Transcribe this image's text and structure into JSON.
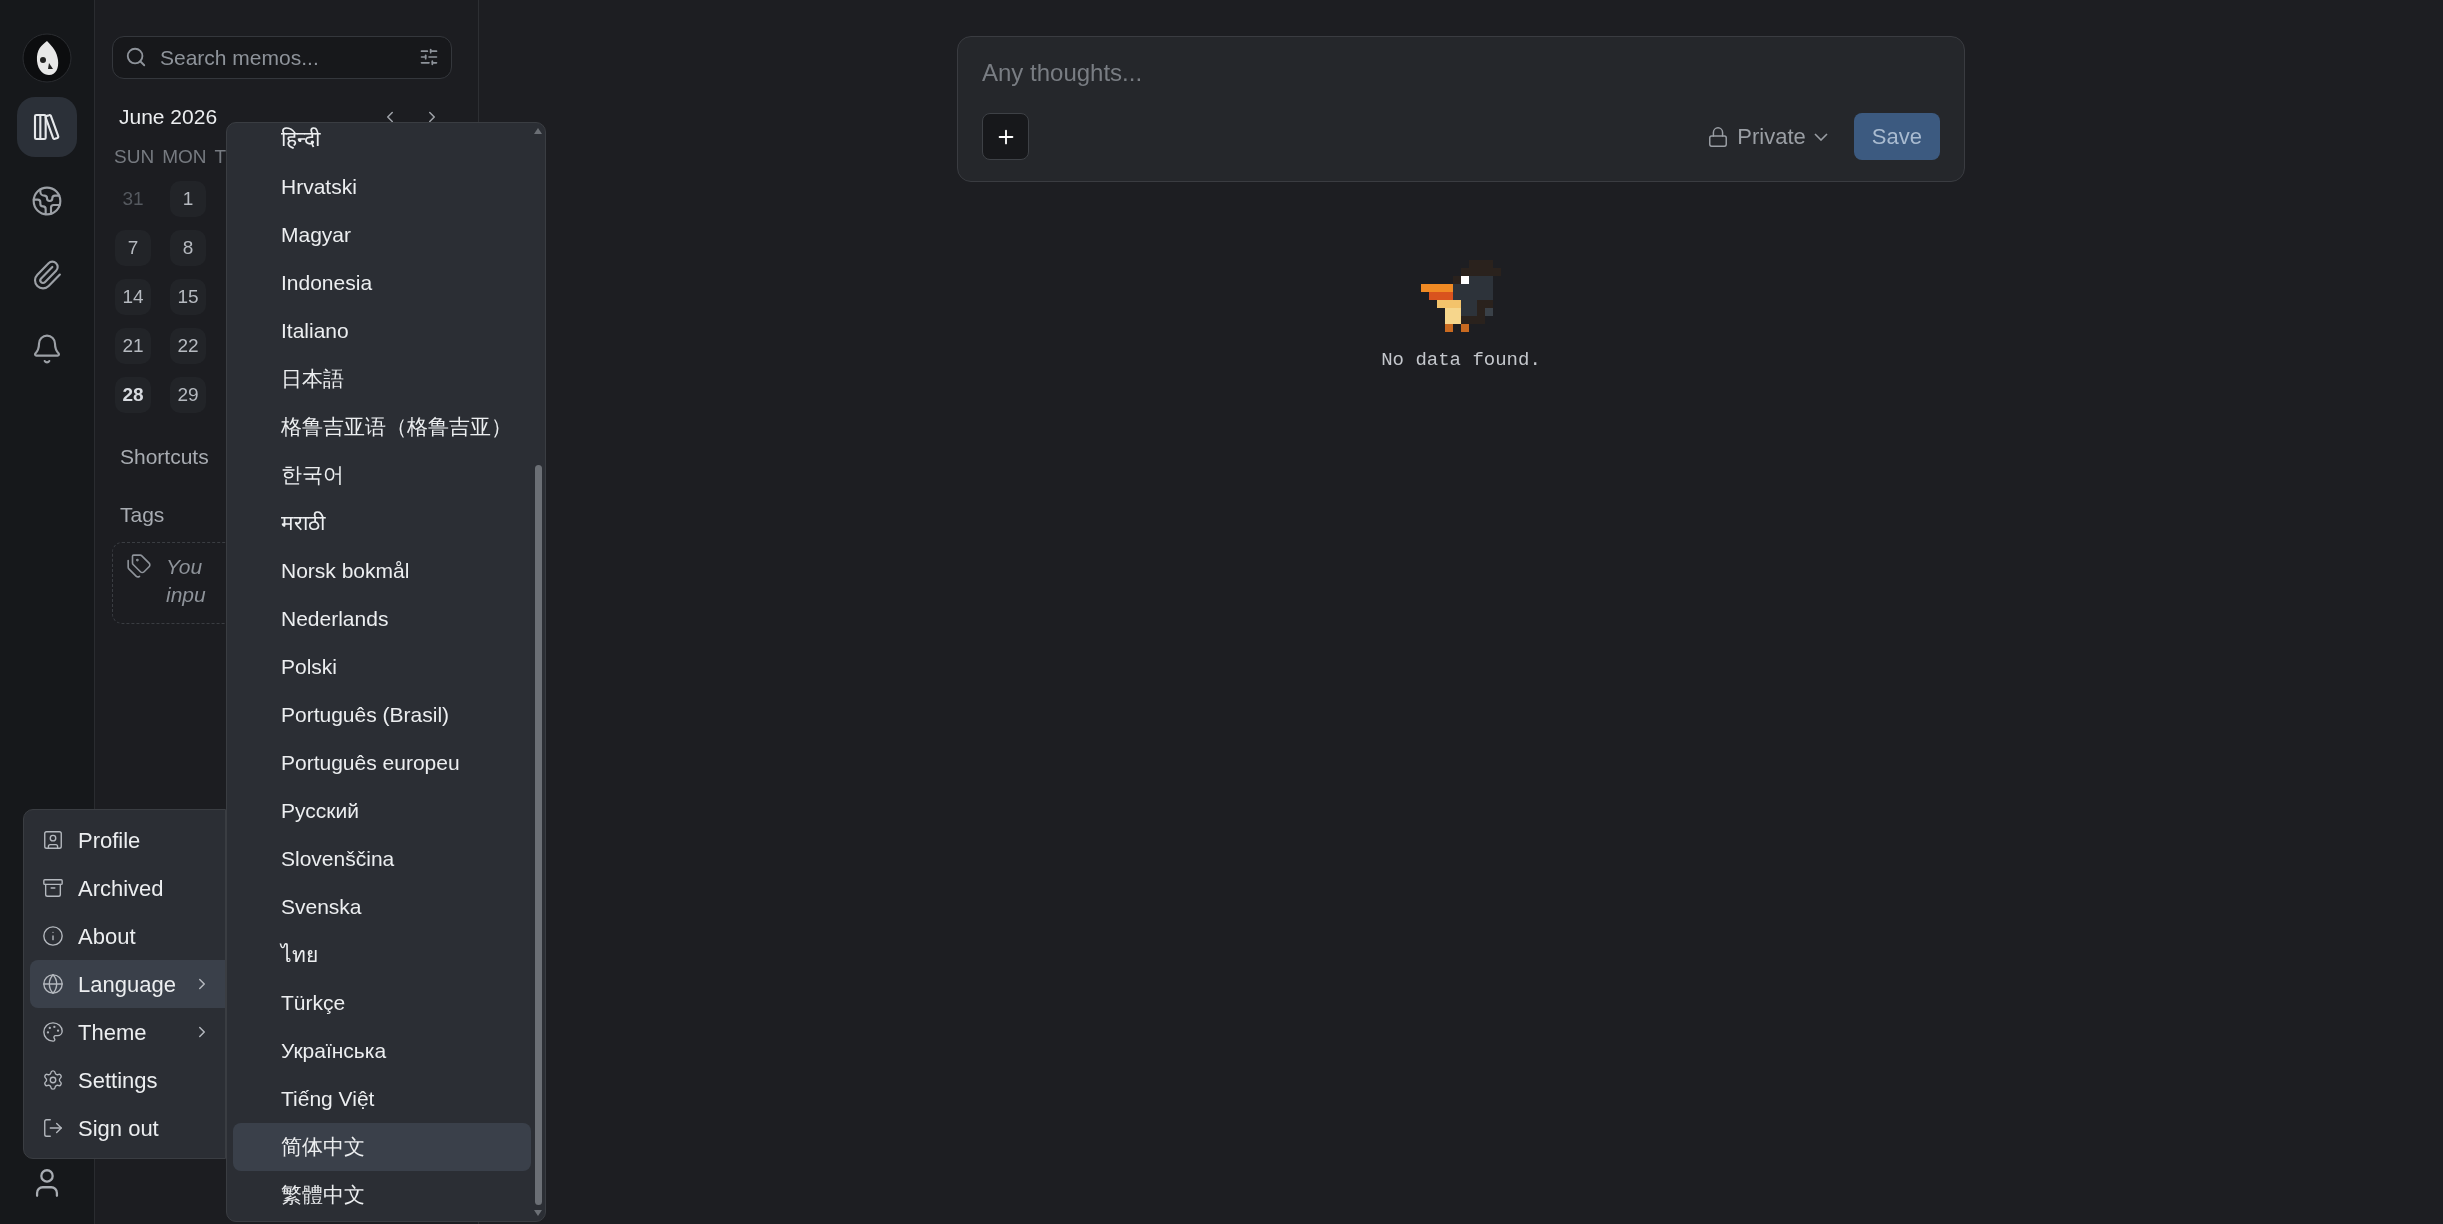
{
  "rail": {
    "items": [
      {
        "kind": "library",
        "selected": true
      },
      {
        "kind": "explore",
        "selected": false
      },
      {
        "kind": "attachments",
        "selected": false
      },
      {
        "kind": "notifications",
        "selected": false
      }
    ]
  },
  "sidebar": {
    "search": {
      "placeholder": "Search memos..."
    },
    "calendar": {
      "month": "June 2026",
      "weekdays": [
        "SUN",
        "MON",
        "T"
      ],
      "days": [
        {
          "label": "31",
          "muted": true,
          "today": false
        },
        {
          "label": "1",
          "muted": false,
          "today": false
        },
        {
          "label": "7",
          "muted": false,
          "today": false
        },
        {
          "label": "8",
          "muted": false,
          "today": false
        },
        {
          "label": "14",
          "muted": false,
          "today": false
        },
        {
          "label": "15",
          "muted": false,
          "today": false
        },
        {
          "label": "21",
          "muted": false,
          "today": false
        },
        {
          "label": "22",
          "muted": false,
          "today": false
        },
        {
          "label": "28",
          "muted": false,
          "today": true
        },
        {
          "label": "29",
          "muted": false,
          "today": false
        }
      ]
    },
    "shortcuts_heading": "Shortcuts",
    "tags_heading": "Tags",
    "tags_hint_lines": [
      "You",
      "inpu"
    ]
  },
  "user_menu": {
    "items": [
      {
        "kind": "profile",
        "label": "Profile",
        "selected": false,
        "submenu": false
      },
      {
        "kind": "archive",
        "label": "Archived",
        "selected": false,
        "submenu": false
      },
      {
        "kind": "about",
        "label": "About",
        "selected": false,
        "submenu": false
      },
      {
        "kind": "language",
        "label": "Language",
        "selected": true,
        "submenu": true
      },
      {
        "kind": "theme",
        "label": "Theme",
        "selected": false,
        "submenu": true
      },
      {
        "kind": "settings",
        "label": "Settings",
        "selected": false,
        "submenu": false
      },
      {
        "kind": "signout",
        "label": "Sign out",
        "selected": false,
        "submenu": false
      }
    ]
  },
  "language_menu": {
    "items": [
      {
        "label": "हिन्दी",
        "selected": false
      },
      {
        "label": "Hrvatski",
        "selected": false
      },
      {
        "label": "Magyar",
        "selected": false
      },
      {
        "label": "Indonesia",
        "selected": false
      },
      {
        "label": "Italiano",
        "selected": false
      },
      {
        "label": "日本語",
        "selected": false
      },
      {
        "label": "格鲁吉亚语（格鲁吉亚）",
        "selected": false
      },
      {
        "label": "한국어",
        "selected": false
      },
      {
        "label": "मराठी",
        "selected": false
      },
      {
        "label": "Norsk bokmål",
        "selected": false
      },
      {
        "label": "Nederlands",
        "selected": false
      },
      {
        "label": "Polski",
        "selected": false
      },
      {
        "label": "Português (Brasil)",
        "selected": false
      },
      {
        "label": "Português europeu",
        "selected": false
      },
      {
        "label": "Русский",
        "selected": false
      },
      {
        "label": "Slovenščina",
        "selected": false
      },
      {
        "label": "Svenska",
        "selected": false
      },
      {
        "label": "ไทย",
        "selected": false
      },
      {
        "label": "Türkçe",
        "selected": false
      },
      {
        "label": "Українська",
        "selected": false
      },
      {
        "label": "Tiếng Việt",
        "selected": false
      },
      {
        "label": "简体中文",
        "selected": true
      },
      {
        "label": "繁體中文",
        "selected": false
      }
    ]
  },
  "editor": {
    "placeholder": "Any thoughts...",
    "visibility": "Private",
    "save": "Save"
  },
  "empty_state": {
    "message": "No data found."
  }
}
